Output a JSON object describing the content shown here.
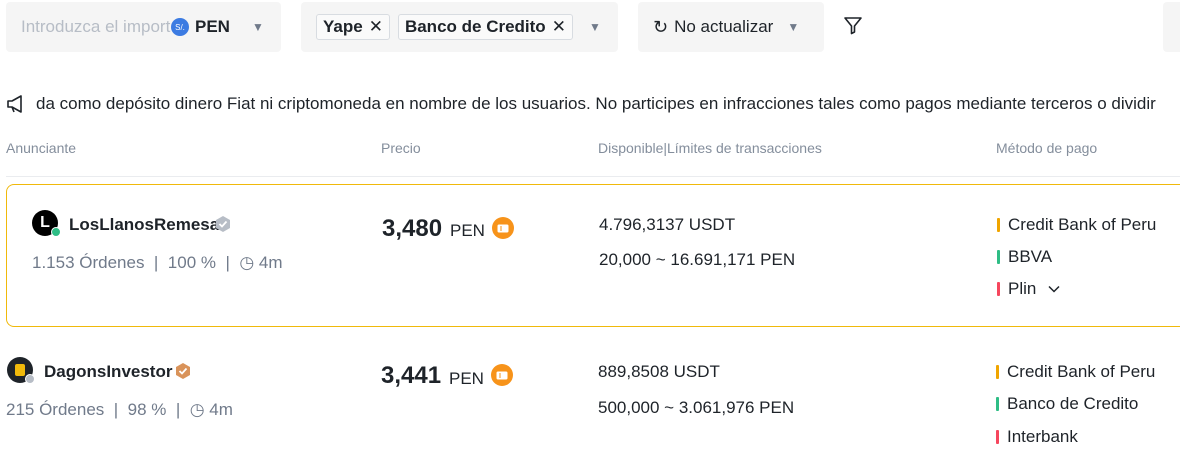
{
  "filters": {
    "amount_placeholder": "Introduzca el importe",
    "currency_code": "PEN",
    "currency_symbol": "S/.",
    "payment_tags": [
      "Yape",
      "Banco de Credito"
    ],
    "refresh_label": "No actualizar"
  },
  "notice": {
    "text": "da como depósito dinero Fiat ni criptomoneda en nombre de los usuarios. No participes en infracciones tales como pagos mediante terceros o dividir"
  },
  "table": {
    "headers": {
      "advertiser": "Anunciante",
      "price": "Precio",
      "available": "Disponible|Límites de transacciones",
      "payment": "Método de pago"
    }
  },
  "offers": [
    {
      "avatar_letter": "L",
      "name": "LosLlanosRemesa",
      "orders": "1.153 Órdenes",
      "completion": "100 %",
      "time": "4m",
      "price": "3,480",
      "price_currency": "PEN",
      "available": "4.796,3137 USDT",
      "limits": "20,000 ~ 16.691,171 PEN",
      "methods": [
        {
          "name": "Credit Bank of Peru",
          "color": "#f0a500"
        },
        {
          "name": "BBVA",
          "color": "#2ebd85"
        },
        {
          "name": "Plin",
          "color": "#f6465d",
          "expand": true
        }
      ]
    },
    {
      "avatar_letter": "",
      "name": "DagonsInvestor",
      "orders": "215 Órdenes",
      "completion": "98 %",
      "time": "4m",
      "price": "3,441",
      "price_currency": "PEN",
      "available": "889,8508 USDT",
      "limits": "500,000 ~ 3.061,976 PEN",
      "methods": [
        {
          "name": "Credit Bank of Peru",
          "color": "#f0a500"
        },
        {
          "name": "Banco de Credito",
          "color": "#2ebd85"
        },
        {
          "name": "Interbank",
          "color": "#f6465d"
        }
      ]
    }
  ]
}
